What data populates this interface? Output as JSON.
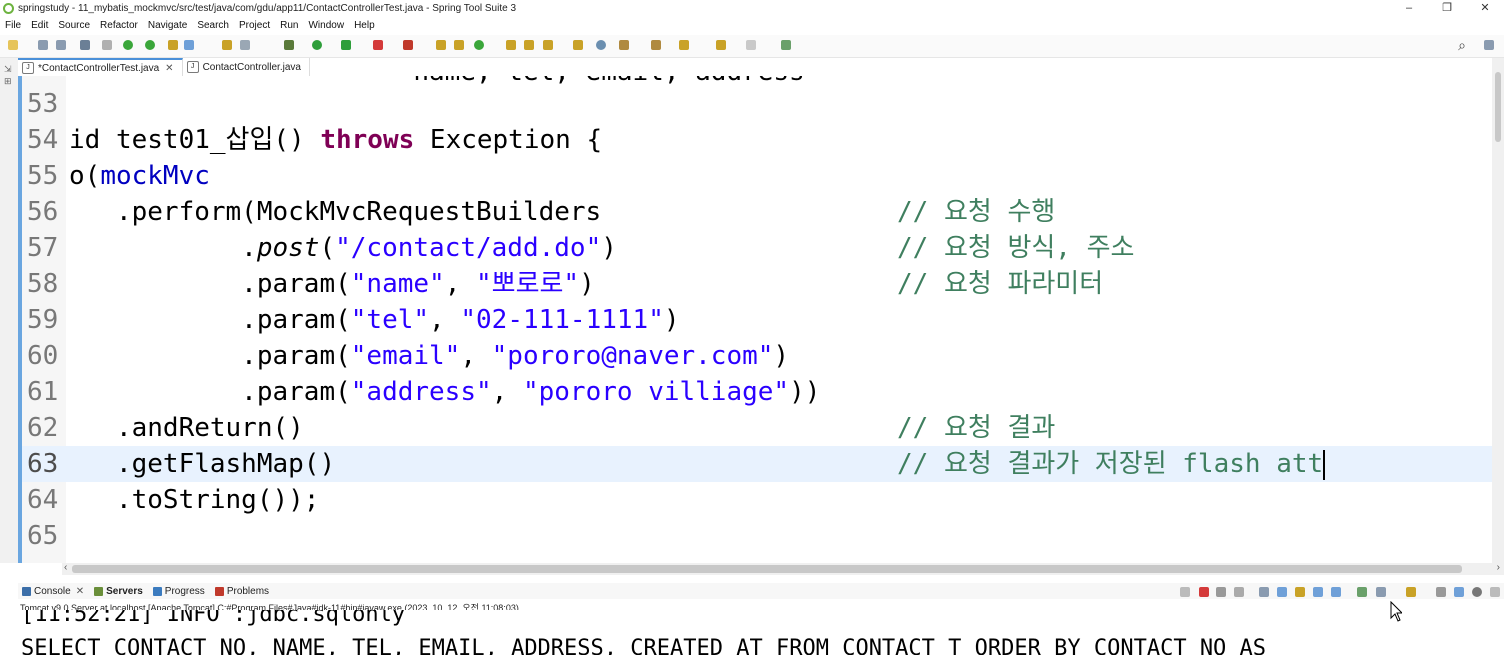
{
  "window": {
    "title": "springstudy - 11_mybatis_mockmvc/src/test/java/com/gdu/app11/ContactControllerTest.java - Spring Tool Suite 3",
    "buttons": [
      "–",
      "❐",
      "✕"
    ]
  },
  "menu": [
    "File",
    "Edit",
    "Source",
    "Refactor",
    "Navigate",
    "Search",
    "Project",
    "Run",
    "Window",
    "Help"
  ],
  "editor_tabs": [
    {
      "label": "*ContactControllerTest.java",
      "active": true,
      "close": "✕"
    },
    {
      "label": "ContactController.java",
      "active": false
    }
  ],
  "code_lines": [
    {
      "num": "53",
      "code": "",
      "comment": ""
    },
    {
      "num": "54",
      "code": "id test01_삽입() throws Exception {",
      "comment": ""
    },
    {
      "num": "55",
      "code": "o(mockMvc",
      "comment": ""
    },
    {
      "num": "56",
      "code": "   .perform(MockMvcRequestBuilders",
      "comment": "// 요청 수행"
    },
    {
      "num": "57",
      "code": "           .post(\"/contact/add.do\")",
      "comment": "// 요청 방식, 주소"
    },
    {
      "num": "58",
      "code": "           .param(\"name\", \"뽀로로\")",
      "comment": "// 요청 파라미터"
    },
    {
      "num": "59",
      "code": "           .param(\"tel\", \"02-111-1111\")",
      "comment": ""
    },
    {
      "num": "60",
      "code": "           .param(\"email\", \"pororo@naver.com\")",
      "comment": ""
    },
    {
      "num": "61",
      "code": "           .param(\"address\", \"pororo villiage\"))",
      "comment": ""
    },
    {
      "num": "62",
      "code": "   .andReturn()",
      "comment": "// 요청 결과"
    },
    {
      "num": "63",
      "code": "   .getFlashMap()",
      "comment": "// 요청 결과가 저장된 flash att"
    },
    {
      "num": "64",
      "code": "   .toString());",
      "comment": ""
    },
    {
      "num": "65",
      "code": "",
      "comment": ""
    }
  ],
  "top_partial_line": "                      name, tel, email, address",
  "panel_tabs": [
    {
      "label": "Console",
      "close": "✕",
      "color": "#3b6ea8"
    },
    {
      "label": "Servers",
      "active": true,
      "color": "#6a8f3a"
    },
    {
      "label": "Progress",
      "color": "#3b7bbf"
    },
    {
      "label": "Problems",
      "color": "#c0392b"
    }
  ],
  "server_info": "Tomcat v9.0 Server at localhost [Apache Tomcat] C:#Program Files#Java#jdk-11#bin#javaw.exe  (2023. 10. 12. 오전 11:08:03)",
  "console_lines": [
    "[11:52:21] INFO :jdbc.sqlonly",
    "SELECT CONTACT_NO, NAME, TEL, EMAIL, ADDRESS, CREATED_AT FROM CONTACT_T ORDER BY CONTACT_NO AS"
  ]
}
